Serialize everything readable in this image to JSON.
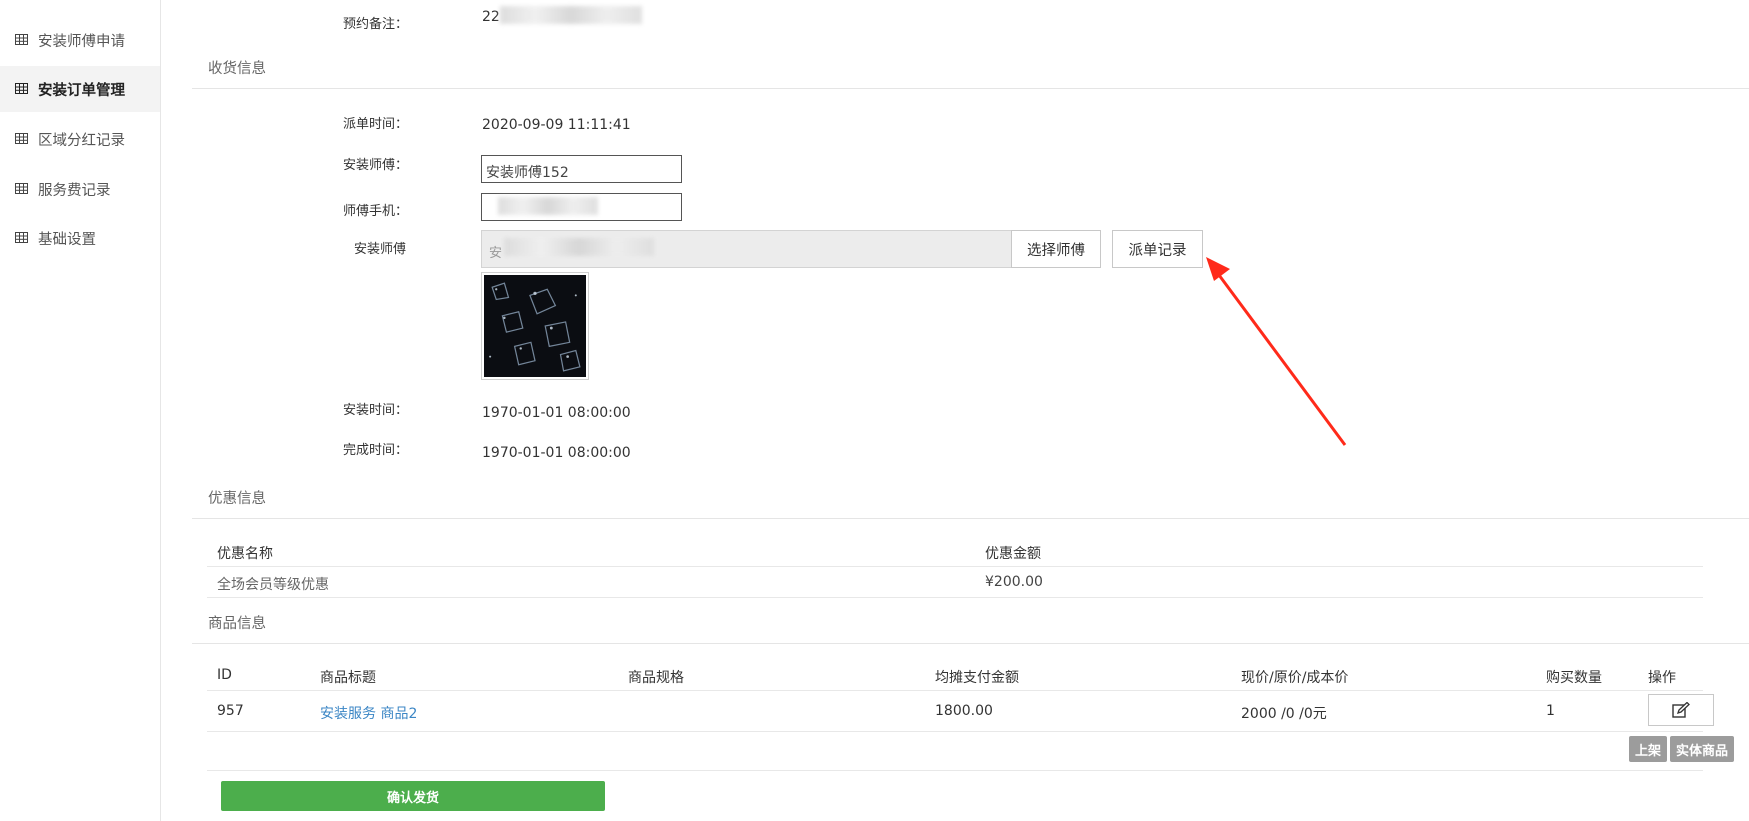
{
  "sidebar": {
    "items": [
      {
        "label": "安装师傅申请",
        "active": false
      },
      {
        "label": "安装订单管理",
        "active": true
      },
      {
        "label": "区域分红记录",
        "active": false
      },
      {
        "label": "服务费记录",
        "active": false
      },
      {
        "label": "基础设置",
        "active": false
      }
    ]
  },
  "top": {
    "remark_label": "预约备注：",
    "remark_value": "22"
  },
  "shipping": {
    "title": "收货信息",
    "dispatch_time_label": "派单时间：",
    "dispatch_time_value": "2020-09-09 11:11:41",
    "installer_label": "安装师傅：",
    "installer_value": "安装师傅152",
    "phone_label": "师傅手机：",
    "phone_value": "",
    "installer_select_label": "安装师傅",
    "installer_select_value": "安",
    "select_button": "选择师傅",
    "dispatch_record_button": "派单记录",
    "install_time_label": "安装时间：",
    "install_time_value": "1970-01-01 08:00:00",
    "finish_time_label": "完成时间：",
    "finish_time_value": "1970-01-01 08:00:00"
  },
  "discount": {
    "title": "优惠信息",
    "headers": [
      "优惠名称",
      "优惠金额"
    ],
    "rows": [
      [
        "全场会员等级优惠",
        "¥200.00"
      ]
    ]
  },
  "goods": {
    "title": "商品信息",
    "headers": [
      "ID",
      "商品标题",
      "商品规格",
      "均摊支付金额",
      "现价/原价/成本价",
      "购买数量",
      "操作"
    ],
    "rows": [
      {
        "id": "957",
        "title": "安装服务 商品2",
        "spec": "",
        "amount": "1800.00",
        "price": "2000 /0 /0元",
        "qty": "1"
      }
    ],
    "tags": [
      "上架",
      "实体商品"
    ]
  },
  "actions": {
    "confirm_button": "确认发货"
  },
  "colors": {
    "confirm_green": "#4cae4c",
    "link_blue": "#3b86c5",
    "tag_gray": "#9c9c9c",
    "annotation_red": "#ff2a1a"
  }
}
